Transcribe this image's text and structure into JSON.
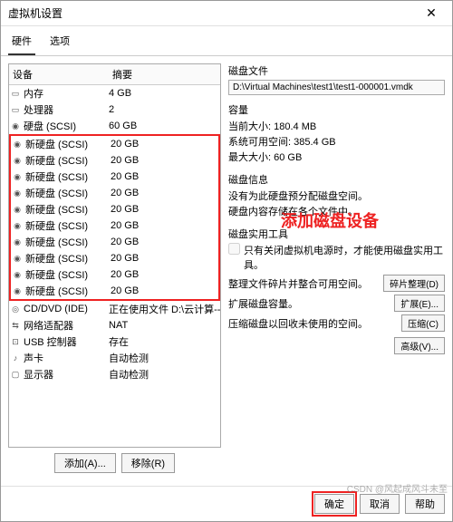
{
  "title": "虚拟机设置",
  "tabs": {
    "hardware": "硬件",
    "options": "选项"
  },
  "columns": {
    "device": "设备",
    "summary": "摘要"
  },
  "devices": [
    {
      "icon": "▭",
      "name": "内存",
      "summary": "4 GB"
    },
    {
      "icon": "▭",
      "name": "处理器",
      "summary": "2"
    },
    {
      "icon": "◉",
      "name": "硬盘 (SCSI)",
      "summary": "60 GB"
    }
  ],
  "new_disks": [
    {
      "icon": "◉",
      "name": "新硬盘 (SCSI)",
      "summary": "20 GB"
    },
    {
      "icon": "◉",
      "name": "新硬盘 (SCSI)",
      "summary": "20 GB"
    },
    {
      "icon": "◉",
      "name": "新硬盘 (SCSI)",
      "summary": "20 GB"
    },
    {
      "icon": "◉",
      "name": "新硬盘 (SCSI)",
      "summary": "20 GB"
    },
    {
      "icon": "◉",
      "name": "新硬盘 (SCSI)",
      "summary": "20 GB"
    },
    {
      "icon": "◉",
      "name": "新硬盘 (SCSI)",
      "summary": "20 GB"
    },
    {
      "icon": "◉",
      "name": "新硬盘 (SCSI)",
      "summary": "20 GB"
    },
    {
      "icon": "◉",
      "name": "新硬盘 (SCSI)",
      "summary": "20 GB"
    },
    {
      "icon": "◉",
      "name": "新硬盘 (SCSI)",
      "summary": "20 GB"
    },
    {
      "icon": "◉",
      "name": "新硬盘 (SCSI)",
      "summary": "20 GB"
    }
  ],
  "devices_after": [
    {
      "icon": "◎",
      "name": "CD/DVD (IDE)",
      "summary": "正在使用文件 D:\\云计算--搭..."
    },
    {
      "icon": "⇆",
      "name": "网络适配器",
      "summary": "NAT"
    },
    {
      "icon": "⊡",
      "name": "USB 控制器",
      "summary": "存在"
    },
    {
      "icon": "♪",
      "name": "声卡",
      "summary": "自动检测"
    },
    {
      "icon": "▢",
      "name": "显示器",
      "summary": "自动检测"
    }
  ],
  "buttons": {
    "add": "添加(A)...",
    "remove": "移除(R)"
  },
  "right": {
    "disk_file_label": "磁盘文件",
    "disk_file_value": "D:\\Virtual Machines\\test1\\test1-000001.vmdk",
    "capacity_label": "容量",
    "current_size": "当前大小: 180.4 MB",
    "free_space": "系统可用空间: 385.4 GB",
    "max_size": "最大大小: 60 GB",
    "disk_info_label": "磁盘信息",
    "disk_info_1": "没有为此硬盘预分配磁盘空间。",
    "disk_info_2": "硬盘内容存储在各个文件中。",
    "tools_label": "磁盘实用工具",
    "checkbox_text": "只有关闭虚拟机电源时，才能使用磁盘实用工具。",
    "defrag_text": "整理文件碎片并整合可用空间。",
    "defrag_btn": "碎片整理(D)",
    "expand_text": "扩展磁盘容量。",
    "expand_btn": "扩展(E)...",
    "compact_text": "压缩磁盘以回收未使用的空间。",
    "compact_btn": "压缩(C)",
    "advanced_btn": "高级(V)..."
  },
  "annotation": "添加磁盘设备",
  "footer": {
    "ok": "确定",
    "cancel": "取消",
    "help": "帮助"
  },
  "watermark": "CSDN @风起成风斗未至"
}
